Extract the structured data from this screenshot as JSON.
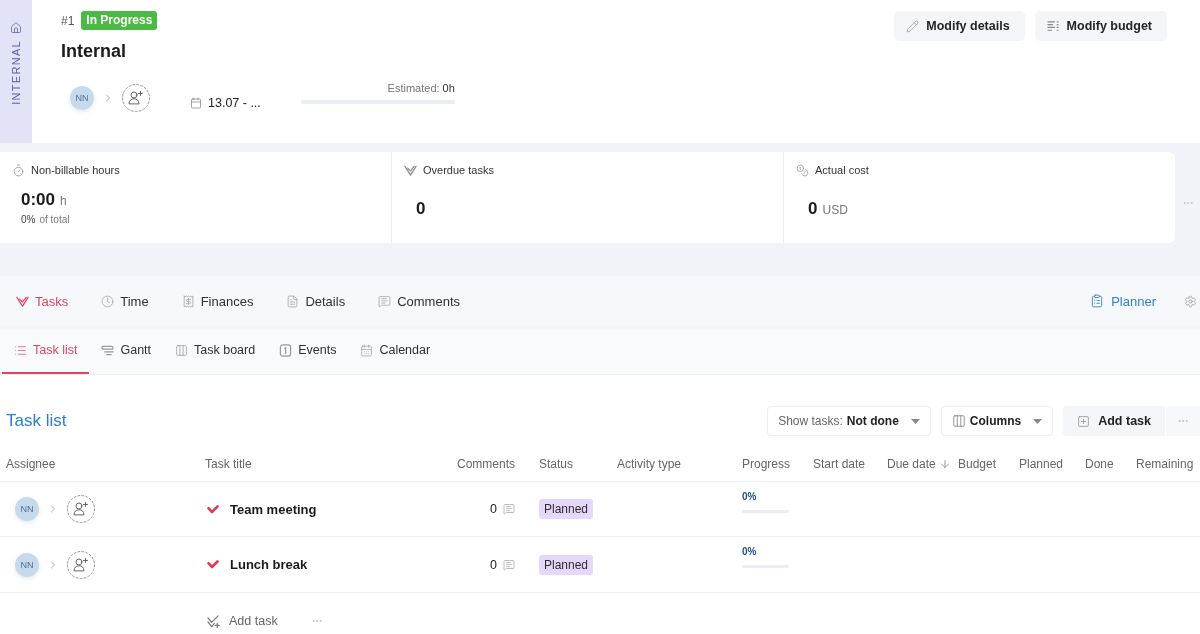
{
  "project": {
    "type_label": "INTERNAL",
    "number": "#1",
    "status": "In Progress",
    "name": "Internal",
    "assignee_initials": "NN",
    "dates": "13.07 - ...",
    "estimate": {
      "label": "Estimated:",
      "value": "0h",
      "level": 0
    },
    "actions": [
      "Modify details",
      "Modify budget"
    ]
  },
  "stats": [
    {
      "title": "Non-billable hours",
      "value": "0:00",
      "unit": "h",
      "share": "0%",
      "share_label": "of total"
    },
    {
      "title": "Overdue tasks",
      "value": "0"
    },
    {
      "title": "Actual cost",
      "value": "0",
      "unit": "USD"
    }
  ],
  "tabs": [
    {
      "label": "Tasks",
      "selected": true
    },
    {
      "label": "Time",
      "selected": false
    },
    {
      "label": "Finances",
      "selected": false
    },
    {
      "label": "Details",
      "selected": false
    },
    {
      "label": "Comments",
      "selected": false
    }
  ],
  "planner_link": "Planner",
  "views": [
    {
      "label": "Task list",
      "selected": true
    },
    {
      "label": "Gantt",
      "selected": false
    },
    {
      "label": "Task board",
      "selected": false
    },
    {
      "label": "Events",
      "selected": false
    },
    {
      "label": "Calendar",
      "selected": false
    }
  ],
  "task_list": {
    "title": "Task list",
    "filter": {
      "label": "Show tasks:",
      "value": "Not done"
    },
    "columns_button": "Columns",
    "add_button": "Add task",
    "table": {
      "columns": [
        {
          "label": "Assignee",
          "sorted": false
        },
        {
          "label": "Task title",
          "sorted": false
        },
        {
          "label": "Comments",
          "sorted": false
        },
        {
          "label": "Status",
          "sorted": false
        },
        {
          "label": "Activity type",
          "sorted": false
        },
        {
          "label": "Progress",
          "sorted": false
        },
        {
          "label": "Start date",
          "sorted": false
        },
        {
          "label": "Due date",
          "sorted": true
        },
        {
          "label": "Budget",
          "sorted": false
        },
        {
          "label": "Planned",
          "sorted": false
        },
        {
          "label": "Done",
          "sorted": false
        },
        {
          "label": "Remaining",
          "sorted": false
        }
      ],
      "rows": [
        {
          "assignee_initials": "NN",
          "title": "Team meeting",
          "comments": "0",
          "status": "Planned",
          "progress": "0%",
          "level": 0
        },
        {
          "assignee_initials": "NN",
          "title": "Lunch break",
          "comments": "0",
          "status": "Planned",
          "progress": "0%",
          "level": 0
        }
      ]
    },
    "add_row": "Add task"
  }
}
